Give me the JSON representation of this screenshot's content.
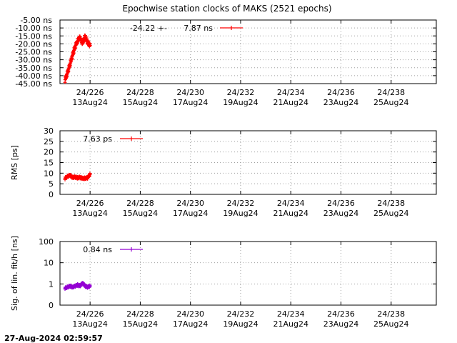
{
  "title": "Epochwise station clocks of MAKS (2521 epochs)",
  "timestamp": "27-Aug-2024 02:59:57",
  "chart_data": [
    {
      "type": "scatter",
      "ylabel": "",
      "ylim": [
        -45,
        -5
      ],
      "yticks": [
        "-5.00 ns",
        "-10.00 ns",
        "-15.00 ns",
        "-20.00 ns",
        "-25.00 ns",
        "-30.00 ns",
        "-35.00 ns",
        "-40.00 ns",
        "-45.00 ns"
      ],
      "yvals": [
        -5,
        -10,
        -15,
        -20,
        -25,
        -30,
        -35,
        -40,
        -45
      ],
      "legend": {
        "text1": "-24.22 +-",
        "text2": "7.87 ns"
      },
      "color": "#ff0000",
      "x": [
        225.0,
        225.1,
        225.2,
        225.3,
        225.4,
        225.5,
        225.6,
        225.7,
        225.8,
        225.9,
        226.0
      ],
      "y": [
        -43,
        -38,
        -33,
        -27,
        -22,
        -18,
        -16,
        -20,
        -15,
        -19,
        -21
      ]
    },
    {
      "type": "scatter",
      "ylabel": "RMS [ps]",
      "ylim": [
        0,
        30
      ],
      "yticks": [
        "0",
        "5",
        "10",
        "15",
        "20",
        "25",
        "30"
      ],
      "yvals": [
        0,
        5,
        10,
        15,
        20,
        25,
        30
      ],
      "legend": {
        "text1": "",
        "text2": "7.63 ps"
      },
      "color": "#ff0000",
      "x": [
        225.0,
        225.1,
        225.2,
        225.3,
        225.4,
        225.5,
        225.6,
        225.7,
        225.8,
        225.9,
        226.0
      ],
      "y": [
        7.5,
        8.5,
        9.0,
        8.0,
        8.2,
        7.8,
        8.0,
        7.5,
        7.6,
        7.8,
        9.5
      ]
    },
    {
      "type": "scatter",
      "ylabel": "Sig. of lin. fit/h [ns]",
      "ylim": [
        0,
        100
      ],
      "yticks": [
        "0",
        "1",
        "10",
        "100"
      ],
      "yvals": [
        0,
        1,
        10,
        100
      ],
      "legend": {
        "text1": "",
        "text2": "0.84 ns"
      },
      "color": "#9400d3",
      "x": [
        225.0,
        225.1,
        225.2,
        225.3,
        225.4,
        225.5,
        225.6,
        225.7,
        225.8,
        225.9,
        226.0
      ],
      "y": [
        0.8,
        0.85,
        0.9,
        0.85,
        0.9,
        0.95,
        0.9,
        1.1,
        0.9,
        0.85,
        0.9
      ]
    }
  ],
  "xaxis": {
    "range": [
      224.8,
      239.8
    ],
    "ticks": [
      226,
      228,
      230,
      232,
      234,
      236,
      238
    ],
    "labels1": [
      "24/226",
      "24/228",
      "24/230",
      "24/232",
      "24/234",
      "24/236",
      "24/238"
    ],
    "labels2": [
      "13Aug24",
      "15Aug24",
      "17Aug24",
      "19Aug24",
      "21Aug24",
      "23Aug24",
      "25Aug24"
    ]
  }
}
